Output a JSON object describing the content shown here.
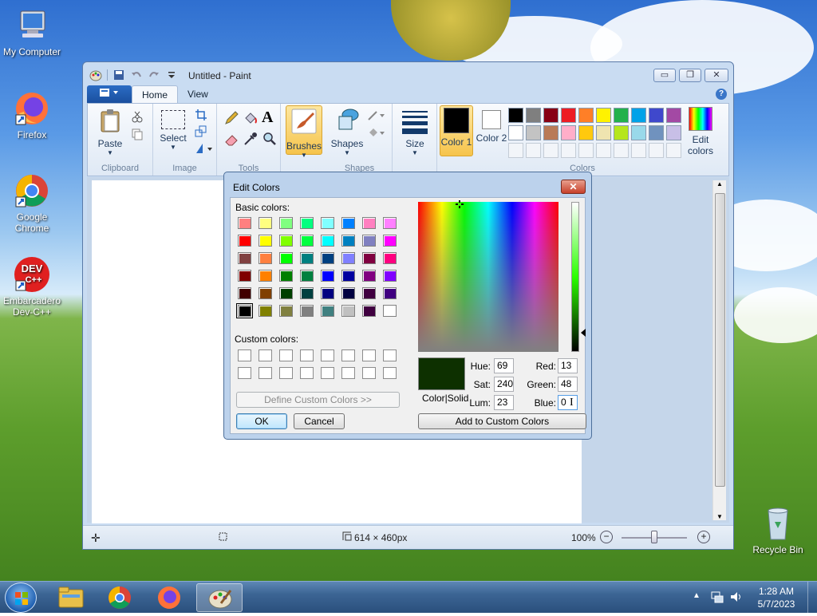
{
  "desktop": {
    "icons": [
      {
        "label": "My Computer"
      },
      {
        "label": "Firefox"
      },
      {
        "label": "Google Chrome"
      },
      {
        "label": "Embarcadero Dev-C++"
      },
      {
        "label": "Recycle Bin"
      }
    ],
    "devcpp_logo_text": "DEV C++"
  },
  "paint": {
    "title": "Untitled - Paint",
    "tabs": {
      "file": "",
      "home": "Home",
      "view": "View"
    },
    "ribbon": {
      "clipboard": {
        "paste": "Paste",
        "group": "Clipboard"
      },
      "image": {
        "select": "Select",
        "group": "Image"
      },
      "tools": {
        "group": "Tools"
      },
      "brushes": "Brushes",
      "shapes": {
        "label": "Shapes",
        "group": "Shapes"
      },
      "size": "Size",
      "color1": "Color 1",
      "color2": "Color 2",
      "colors_group": "Colors",
      "edit_colors": "Edit colors"
    },
    "palette_row1": [
      "#000000",
      "#7f7f7f",
      "#880015",
      "#ed1c24",
      "#ff7f27",
      "#fff200",
      "#22b14c",
      "#00a2e8",
      "#3f48cc",
      "#a349a4"
    ],
    "palette_row2": [
      "#ffffff",
      "#c3c3c3",
      "#b97a57",
      "#ffaec9",
      "#ffc90e",
      "#efe4b0",
      "#b5e61d",
      "#99d9ea",
      "#7092be",
      "#c8bfe7"
    ],
    "status": {
      "canvas_size": "614 × 460px",
      "zoom": "100%"
    }
  },
  "dialog": {
    "title": "Edit Colors",
    "close": "✕",
    "basic_label": "Basic colors:",
    "custom_label": "Custom colors:",
    "define_btn": "Define Custom Colors >>",
    "ok": "OK",
    "cancel": "Cancel",
    "add_btn": "Add to Custom Colors",
    "color_solid": "Color|Solid",
    "preview_color": "#0d3000",
    "hue_label": "Hue:",
    "hue": "69",
    "sat_label": "Sat:",
    "sat": "240",
    "lum_label": "Lum:",
    "lum": "23",
    "red_label": "Red:",
    "red": "13",
    "green_label": "Green:",
    "green": "48",
    "blue_label": "Blue:",
    "blue": "0",
    "basic_colors": [
      [
        "#ff8080",
        "#ffff80",
        "#80ff80",
        "#00ff80",
        "#80ffff",
        "#0080ff",
        "#ff80c0",
        "#ff80ff"
      ],
      [
        "#ff0000",
        "#ffff00",
        "#80ff00",
        "#00ff40",
        "#00ffff",
        "#0080c0",
        "#8080c0",
        "#ff00ff"
      ],
      [
        "#804040",
        "#ff8040",
        "#00ff00",
        "#008080",
        "#004080",
        "#8080ff",
        "#800040",
        "#ff0080"
      ],
      [
        "#800000",
        "#ff8000",
        "#008000",
        "#008040",
        "#0000ff",
        "#0000a0",
        "#800080",
        "#8000ff"
      ],
      [
        "#400000",
        "#804000",
        "#004000",
        "#004040",
        "#000080",
        "#000040",
        "#400040",
        "#400080"
      ],
      [
        "#000000",
        "#808000",
        "#808040",
        "#808080",
        "#408080",
        "#c0c0c0",
        "#400040",
        "#ffffff"
      ]
    ]
  },
  "taskbar": {
    "time": "1:28 AM",
    "date": "5/7/2023"
  }
}
